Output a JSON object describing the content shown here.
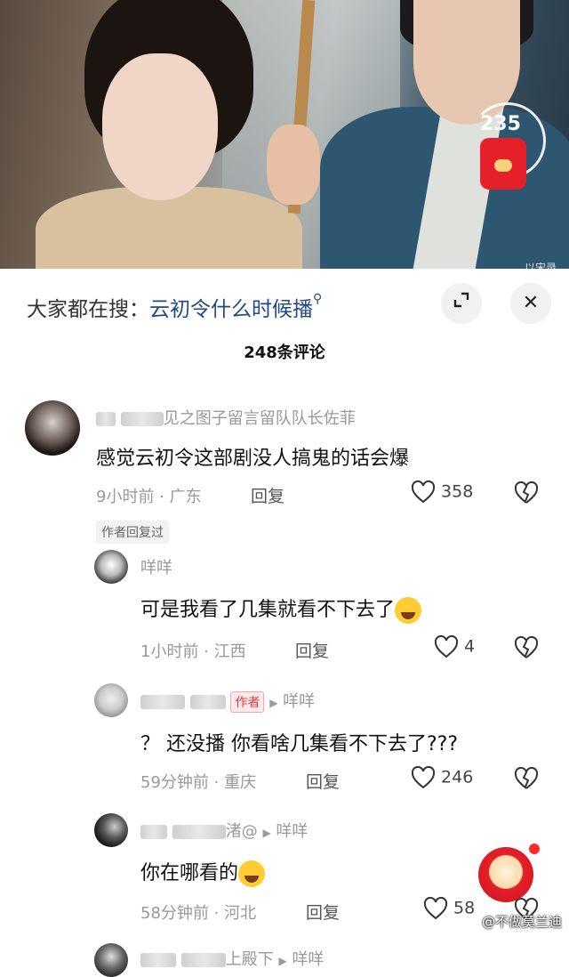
{
  "video": {
    "counter": "235",
    "watermark": "以宋录"
  },
  "search": {
    "prefix": "大家都在搜：",
    "keyword": "云初令什么时候播",
    "icon": "search-icon"
  },
  "title": "248条评论",
  "comments": [
    {
      "name_tail": "见之图子留言留队队长佐菲",
      "text": "感觉云初令这部剧没人搞鬼的话会爆",
      "time": "9小时前 · 广东",
      "reply": "回复",
      "likes": "358",
      "badge": "作者回复过"
    },
    {
      "name": "咩咩",
      "text": "可是我看了几集就看不下去了",
      "time": "1小时前 · 江西",
      "reply": "回复",
      "likes": "4"
    },
    {
      "author_tag": "作者",
      "reply_to": "咩咩",
      "text": "？ 还没播 你看啥几集看不下去了???",
      "time": "59分钟前 · 重庆",
      "reply": "回复",
      "likes": "246"
    },
    {
      "name_tail": "渚@",
      "reply_to": "咩咩",
      "text": "你在哪看的",
      "time": "58分钟前 · 河北",
      "reply": "回复",
      "likes": "58"
    },
    {
      "name_tail": "上殿下",
      "reply_to": "咩咩"
    }
  ],
  "watermark": "@不做莫兰迪"
}
